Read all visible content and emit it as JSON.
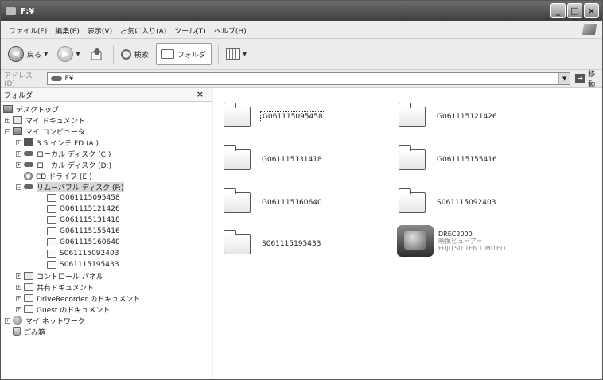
{
  "window": {
    "title": "F:¥"
  },
  "menu": [
    "ファイル(F)",
    "編集(E)",
    "表示(V)",
    "お気に入り(A)",
    "ツール(T)",
    "ヘルプ(H)"
  ],
  "toolbar": {
    "back_label": "戻る",
    "search_label": "検索",
    "folders_label": "フォルダ"
  },
  "address": {
    "label": "アドレス(D)",
    "value": "F¥",
    "go_label": "移動"
  },
  "folders_pane": {
    "title": "フォルダ",
    "close": "×"
  },
  "tree": [
    {
      "label": "デスクトップ",
      "icon": "desktop-icon"
    },
    {
      "label": "マイ ドキュメント",
      "icon": "documents-icon"
    },
    {
      "label": "マイ コンピュータ",
      "icon": "computer-icon"
    },
    {
      "label": "3.5 インチ FD (A:)",
      "icon": "floppy-icon"
    },
    {
      "label": "ローカル ディスク (C:)",
      "icon": "drive-icon"
    },
    {
      "label": "ローカル ディスク (D:)",
      "icon": "drive-icon"
    },
    {
      "label": "CD ドライブ (E:)",
      "icon": "cd-icon"
    },
    {
      "label": "リムーバブル ディスク (F:)",
      "icon": "removable-drive-icon"
    },
    {
      "label": "G061115095458",
      "icon": "folder-icon"
    },
    {
      "label": "G061115121426",
      "icon": "folder-icon"
    },
    {
      "label": "G061115131418",
      "icon": "folder-icon"
    },
    {
      "label": "G061115155416",
      "icon": "folder-icon"
    },
    {
      "label": "G061115160640",
      "icon": "folder-icon"
    },
    {
      "label": "S061115092403",
      "icon": "folder-icon"
    },
    {
      "label": "S061115195433",
      "icon": "folder-icon"
    },
    {
      "label": "コントロール パネル",
      "icon": "control-panel-icon"
    },
    {
      "label": "共有ドキュメント",
      "icon": "folder-icon"
    },
    {
      "label": "DriveRecorder のドキュメント",
      "icon": "folder-icon"
    },
    {
      "label": "Guest のドキュメント",
      "icon": "folder-icon"
    },
    {
      "label": "マイ ネットワーク",
      "icon": "network-icon"
    },
    {
      "label": "ごみ箱",
      "icon": "recycle-bin-icon"
    }
  ],
  "files": [
    {
      "name": "G061115095458"
    },
    {
      "name": "G061115121426"
    },
    {
      "name": "G061115131418"
    },
    {
      "name": "G061115155416"
    },
    {
      "name": "G061115160640"
    },
    {
      "name": "S061115092403"
    },
    {
      "name": "S061115195433"
    }
  ],
  "app_item": {
    "name": "DREC2000",
    "line2": "映像ビューアー",
    "line3": "FUJITSU TEN LIMITED."
  }
}
